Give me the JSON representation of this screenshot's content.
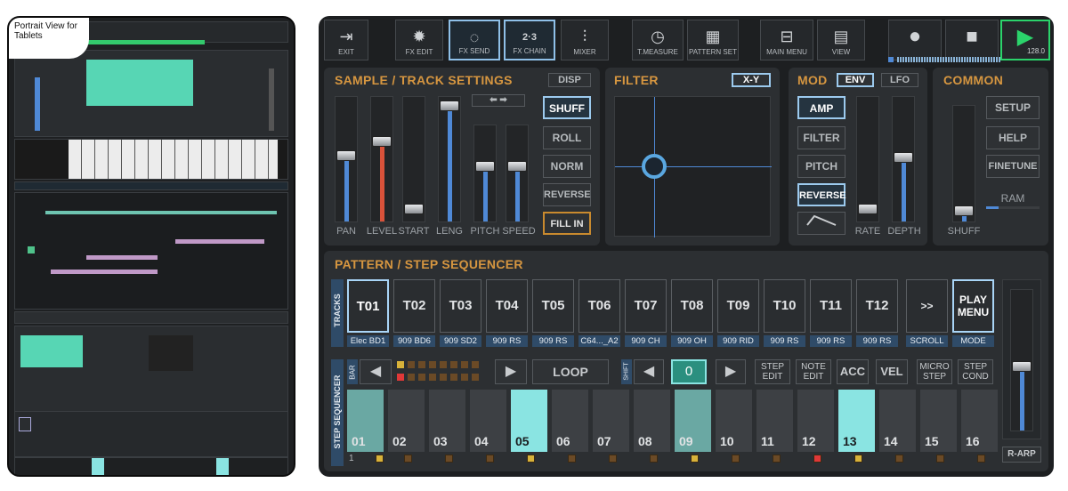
{
  "caption": "Portrait View for Tablets",
  "toolbar": [
    {
      "label": "EXIT",
      "icon": "exit-icon"
    },
    {
      "label": "FX EDIT",
      "icon": "sun-icon"
    },
    {
      "label": "FX SEND",
      "icon": "ring-icon"
    },
    {
      "label": "FX CHAIN",
      "icon": "chain-icon",
      "badge": "2·3"
    },
    {
      "label": "MIXER",
      "icon": "mixer-icon"
    },
    {
      "label": "T.MEASURE",
      "icon": "gauge-icon"
    },
    {
      "label": "PATTERN SET",
      "icon": "grid-icon"
    },
    {
      "label": "MAIN MENU",
      "icon": "inbox-icon"
    },
    {
      "label": "VIEW",
      "icon": "view-icon"
    }
  ],
  "transport": {
    "tempo": "128.0"
  },
  "sample": {
    "title": "SAMPLE / TRACK SETTINGS",
    "disp": "DISP",
    "sliders": [
      "PAN",
      "LEVEL",
      "START",
      "LENG",
      "PITCH",
      "SPEED"
    ],
    "buttons": [
      "SHUFF",
      "ROLL",
      "NORM",
      "REVERSE",
      "FILL IN"
    ]
  },
  "filter": {
    "title": "FILTER",
    "xy": "X-Y"
  },
  "mod": {
    "title": "MOD",
    "env": "ENV",
    "lfo": "LFO",
    "buttons": [
      "AMP",
      "FILTER",
      "PITCH",
      "REVERSE"
    ],
    "sliders": [
      "RATE",
      "DEPTH"
    ]
  },
  "common": {
    "title": "COMMON",
    "buttons": [
      "SETUP",
      "HELP",
      "FINETUNE"
    ],
    "ram": "RAM",
    "slider": "SHUFF"
  },
  "sequencer": {
    "title": "PATTERN / STEP SEQUENCER",
    "tracks_label": "TRACKS",
    "tracks": [
      "T01",
      "T02",
      "T03",
      "T04",
      "T05",
      "T06",
      "T07",
      "T08",
      "T09",
      "T10",
      "T11",
      "T12",
      ">>"
    ],
    "track_names": [
      "Elec BD1",
      "909 BD6",
      "909 SD2",
      "909 RS",
      "909 RS",
      "C64..._A2",
      "909 CH",
      "909 OH",
      "909 RID",
      "909 RS",
      "909 RS",
      "909 RS",
      "SCROLL"
    ],
    "play_menu": "PLAY MENU",
    "mode": "MODE",
    "step_label": "STEP SEQUENCER",
    "bar": "BAR",
    "shift": "SHIFT",
    "loop": "LOOP",
    "counter": "0",
    "controls": [
      "STEP EDIT",
      "NOTE EDIT",
      "ACC",
      "VEL",
      "MICRO STEP",
      "STEP COND"
    ],
    "steps": [
      "01",
      "02",
      "03",
      "04",
      "05",
      "06",
      "07",
      "08",
      "09",
      "10",
      "11",
      "12",
      "13",
      "14",
      "15",
      "16"
    ],
    "bar_number": "1",
    "rarp": "R-ARP"
  },
  "colors": {
    "accent": "#d69640",
    "selected": "#9ccaee",
    "lit_step": "#8ae4e2",
    "play": "#2bd36b"
  }
}
